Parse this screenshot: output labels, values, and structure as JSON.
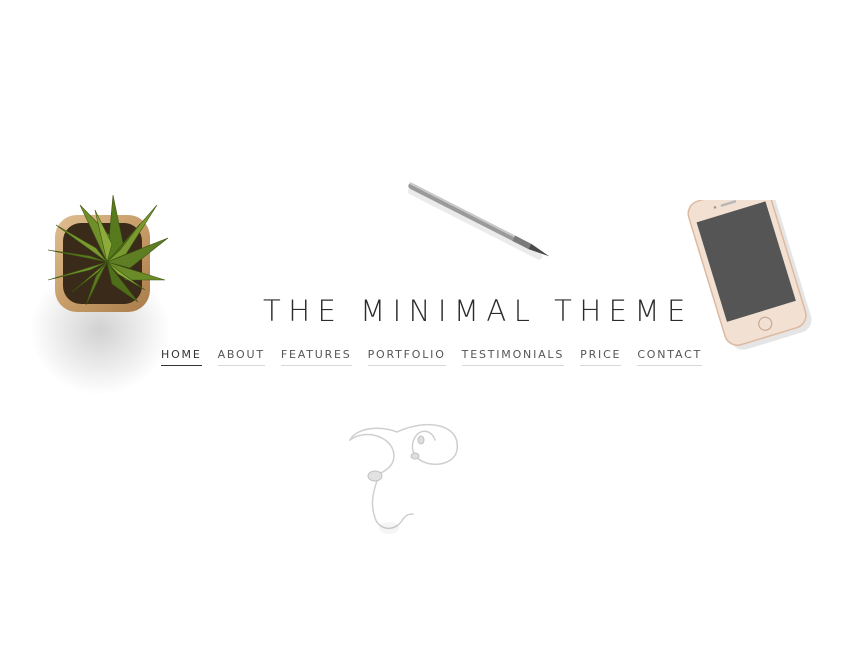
{
  "site": {
    "title": "THE MINIMAL THEME"
  },
  "nav": {
    "items": [
      {
        "label": "HOME",
        "active": true
      },
      {
        "label": "ABOUT",
        "active": false
      },
      {
        "label": "FEATURES",
        "active": false
      },
      {
        "label": "PORTFOLIO",
        "active": false
      },
      {
        "label": "TESTIMONIALS",
        "active": false
      },
      {
        "label": "PRICE",
        "active": false
      },
      {
        "label": "CONTACT",
        "active": false
      }
    ]
  },
  "decorations": {
    "objects": [
      "potted-plant",
      "pen",
      "smartphone",
      "earphones"
    ]
  },
  "colors": {
    "background": "#ffffff",
    "title_text": "#2b2b2b",
    "nav_text": "#555555",
    "active_underline": "#333333",
    "leaf_green": "#5f7d23",
    "pot_wood": "#c8a272",
    "phone_frame": "#e6cdb8",
    "phone_screen": "#555555",
    "pen_metal": "#9a9a9a"
  }
}
